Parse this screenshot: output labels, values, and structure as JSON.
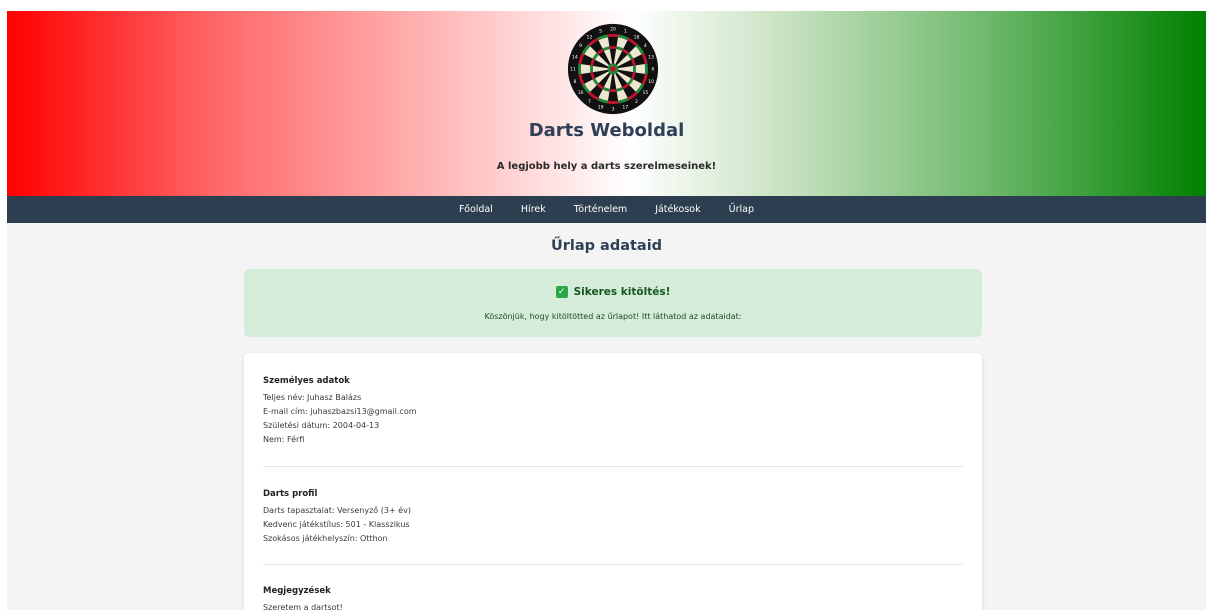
{
  "header": {
    "site_title": "Darts Weboldal",
    "tagline": "A legjobb hely a darts szerelmeseinek!",
    "logo_icon": "dartboard-icon"
  },
  "nav": {
    "items": [
      {
        "label": "Főoldal"
      },
      {
        "label": "Hírek"
      },
      {
        "label": "Történelem"
      },
      {
        "label": "Játékosok"
      },
      {
        "label": "Űrlap"
      }
    ]
  },
  "main": {
    "heading": "Űrlap adataid",
    "success": {
      "icon": "check-icon",
      "title": "Sikeres kitöltés!",
      "message": "Köszönjük, hogy kitöltötted az űrlapot! Itt láthatod az adataidat:"
    },
    "sections": [
      {
        "title": "Személyes adatok",
        "fields": [
          "Teljes név: Juhasz Balázs",
          "E-mail cím: juhaszbazsi13@gmail.com",
          "Születési dátum: 2004-04-13",
          "Nem: Férfi"
        ]
      },
      {
        "title": "Darts profil",
        "fields": [
          "Darts tapasztalat: Versenyző (3+ év)",
          "Kedvenc játékstílus: 501 - Klasszikus",
          "Szokásos játékhelyszín: Otthon"
        ]
      },
      {
        "title": "Megjegyzések",
        "fields": [
          "Szeretem a dartsot!"
        ]
      }
    ]
  },
  "colors": {
    "hero_left": "#ff0000",
    "hero_right": "#008000",
    "navbar": "#2c3e50",
    "success_bg": "#d4ecd9",
    "check": "#27a844"
  }
}
